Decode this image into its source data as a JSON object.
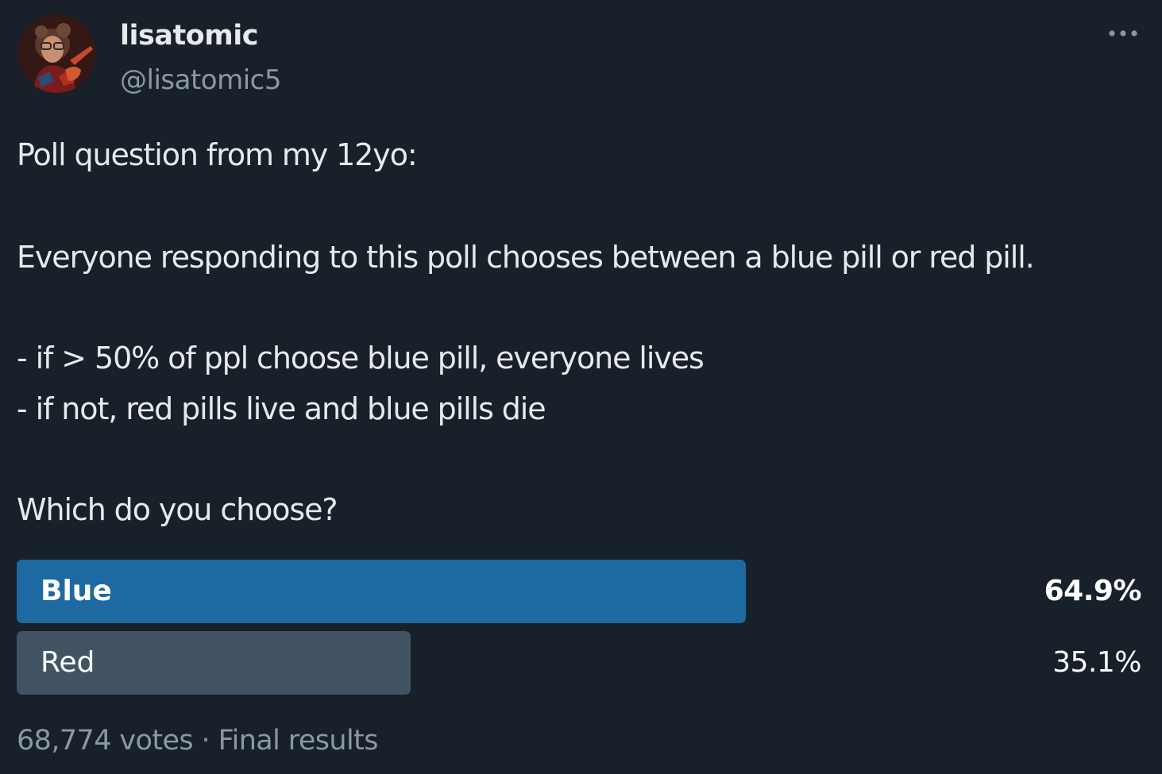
{
  "author": {
    "display_name": "lisatomic",
    "handle": "@lisatomic5"
  },
  "tweet": {
    "lines": [
      "Poll question from my 12yo:",
      "Everyone responding to this poll chooses between a blue pill or red pill.",
      "- if > 50% of ppl choose blue pill, everyone lives",
      "- if not, red pills live and blue pills die",
      "Which do you choose?"
    ]
  },
  "poll": {
    "options": [
      {
        "label": "Blue",
        "percent_text": "64.9%",
        "percent": 64.9,
        "color": "#1d6aa3",
        "winner": true
      },
      {
        "label": "Red",
        "percent_text": "35.1%",
        "percent": 35.1,
        "color": "#425464",
        "winner": false
      }
    ],
    "votes": "68,774 votes",
    "separator": "·",
    "status": "Final results"
  },
  "icons": {
    "more": "more-horizontal-icon",
    "avatar": "user-avatar"
  },
  "colors": {
    "background": "#18202a",
    "text_primary": "#e7e9ea",
    "text_secondary": "#8b98a5",
    "poll_winner": "#1d6aa3",
    "poll_other": "#425464"
  }
}
